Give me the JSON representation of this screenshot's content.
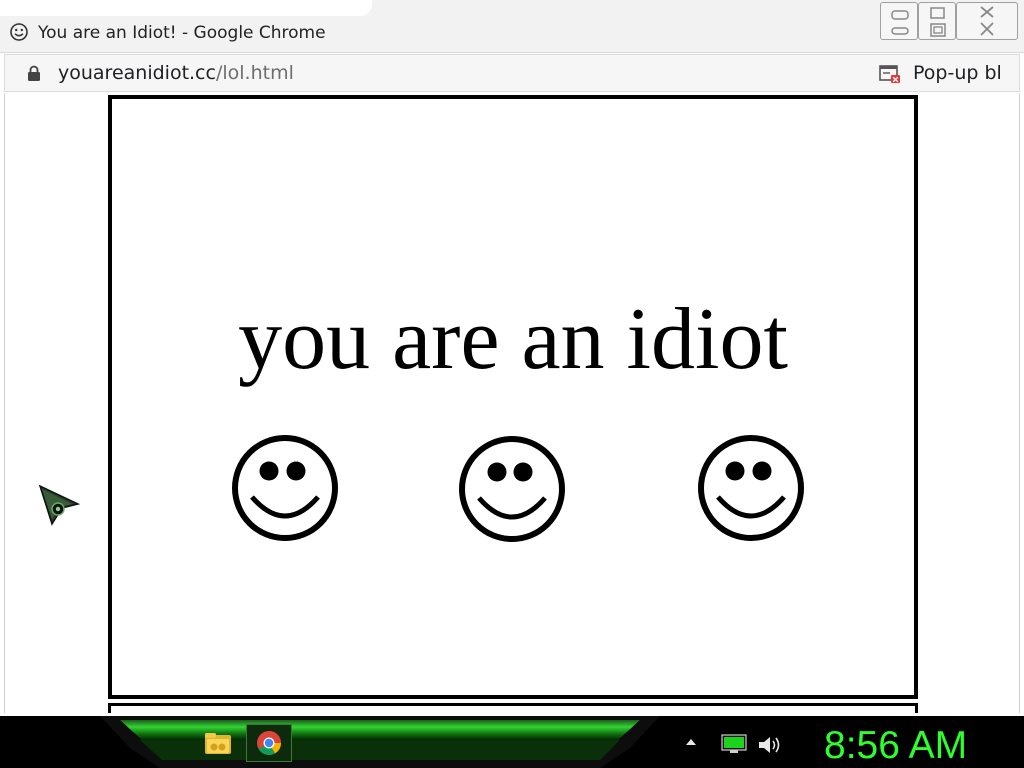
{
  "window": {
    "title": "You are an Idiot! - Google Chrome",
    "title_icon": "smiley-icon"
  },
  "address_bar": {
    "url_domain": "youareanidiot.cc",
    "url_path": "/lol.html",
    "popup_blocked_label": "Pop-up bl",
    "icons": [
      "lock-icon",
      "popup-blocked-icon"
    ]
  },
  "page": {
    "message": "you are an idiot",
    "smileys": [
      "smiley-face-icon",
      "smiley-face-icon",
      "smiley-face-icon"
    ],
    "border_color": "#000000",
    "background_color": "#ffffff"
  },
  "taskbar": {
    "apps": [
      "folder-icon",
      "chrome-icon"
    ],
    "tray": [
      "tray-expand-icon",
      "monitor-icon",
      "volume-icon"
    ],
    "clock": "8:56 AM",
    "clock_color": "#2cff2c",
    "accent_color": "#22c422"
  }
}
